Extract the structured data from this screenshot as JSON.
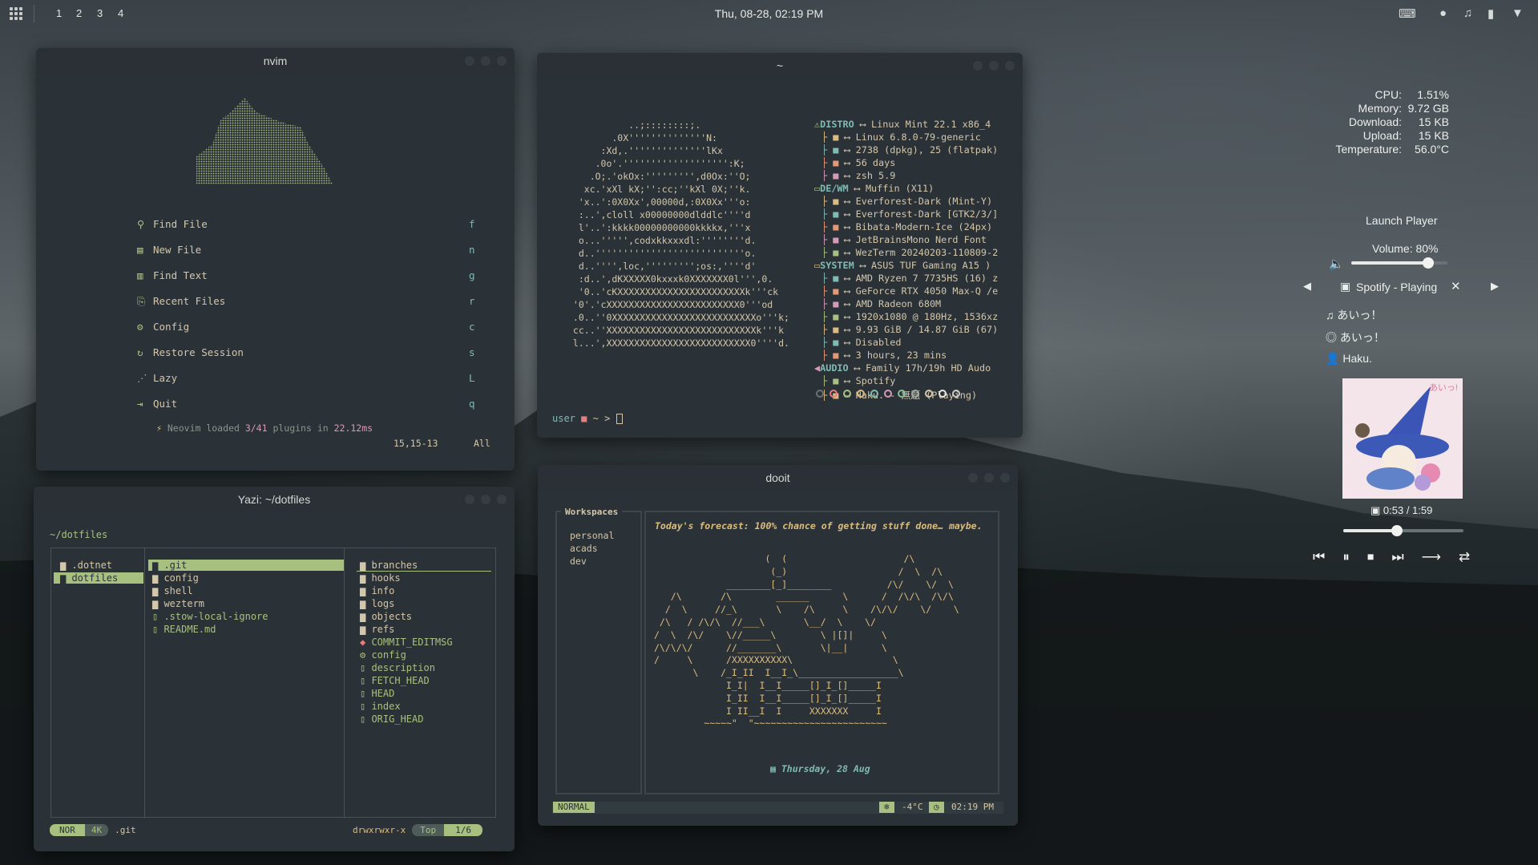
{
  "topbar": {
    "workspaces": [
      "1",
      "2",
      "3",
      "4"
    ],
    "clock": "Thu, 08-28, 02:19 PM"
  },
  "nvim": {
    "title": "nvim",
    "menu": [
      {
        "icon": "search-icon",
        "label": "Find File",
        "key": "f"
      },
      {
        "icon": "file-icon",
        "label": "New File",
        "key": "n"
      },
      {
        "icon": "text-icon",
        "label": "Find Text",
        "key": "g"
      },
      {
        "icon": "history-icon",
        "label": "Recent Files",
        "key": "r"
      },
      {
        "icon": "gear-icon",
        "label": "Config",
        "key": "c"
      },
      {
        "icon": "restore-icon",
        "label": "Restore Session",
        "key": "s"
      },
      {
        "icon": "lazy-icon",
        "label": "Lazy",
        "key": "L"
      },
      {
        "icon": "quit-icon",
        "label": "Quit",
        "key": "q"
      }
    ],
    "footer_prefix": "Neovim loaded ",
    "footer_plugins": "3/41",
    "footer_mid": " plugins in ",
    "footer_time": "22.12ms",
    "cursor_pos": "15,15-13",
    "scroll": "All"
  },
  "terminal": {
    "title": "~",
    "ascii": [
      "           ..;::::::::;.",
      "        .0X''''''''''''''N:",
      "      :Xd,.''''''''''''''lKx",
      "     .0o'.''''''''''''''''''':K;",
      "    .O;.'okOx:''''''''',d0Ox:''O;",
      "   xc.'xXl kX;'':cc;''kXl 0X;''k.",
      "  'x..':0X0Xx',00000d,:0X0Xx'''o:",
      "  :..',cloll x00000000dlddlc''''d",
      "  l'..':kkkk00000000000kkkkx,'''x",
      "  o...''''',codxkkxxxdl:''''''''d.",
      "  d..'''''''''''''''''''''''''''o.",
      "  d..'''',loc,''''''''';os:,''''d'",
      "  :d..',dKXXXXX0kxxxk0XXXXXXX0l''',0.",
      "  '0..'cKXXXXXXXXXXXXXXXXXXXXXXXk'''ck",
      " '0'.'cXXXXXXXXXXXXXXXXXXXXXXXX0'''od",
      " .0..''0XXXXXXXXXXXXXXXXXXXXXXXXXXo'''k;",
      " cc..''XXXXXXXXXXXXXXXXXXXXXXXXXXXk'''k",
      " l...',XXXXXXXXXXXXXXXXXXXXXXXXXX0''''d."
    ],
    "info": [
      {
        "key": "DISTRO",
        "icon": "warning-icon",
        "val": "Linux Mint 22.1 x86_4",
        "header": true
      },
      {
        "key": "",
        "icon": "gear-icon",
        "val": "Linux 6.8.0-79-generic"
      },
      {
        "key": "",
        "icon": "package-icon",
        "val": "2738 (dpkg), 25 (flatpak)"
      },
      {
        "key": "",
        "icon": "uptime-icon",
        "val": "56 days"
      },
      {
        "key": "",
        "icon": "shell-icon",
        "val": "zsh 5.9"
      },
      {
        "key": "DE/WM",
        "icon": "desktop-icon",
        "val": "Muffin (X11)",
        "header": true
      },
      {
        "key": "",
        "icon": "theme-icon",
        "val": "Everforest-Dark (Mint-Y)"
      },
      {
        "key": "",
        "icon": "theme-icon",
        "val": "Everforest-Dark [GTK2/3/]"
      },
      {
        "key": "",
        "icon": "cursor-icon",
        "val": "Bibata-Modern-Ice (24px)"
      },
      {
        "key": "",
        "icon": "font-icon",
        "val": "JetBrainsMono Nerd Font"
      },
      {
        "key": "",
        "icon": "terminal-icon",
        "val": "WezTerm 20240203-110809-2"
      },
      {
        "key": "SYSTEM",
        "icon": "laptop-icon",
        "val": "ASUS TUF Gaming A15 )",
        "header": true
      },
      {
        "key": "",
        "icon": "cpu-icon",
        "val": "AMD Ryzen 7 7735HS (16) z"
      },
      {
        "key": "",
        "icon": "gpu-icon",
        "val": "GeForce RTX 4050 Max-Q /e"
      },
      {
        "key": "",
        "icon": "gpu-icon",
        "val": "AMD Radeon 680M"
      },
      {
        "key": "",
        "icon": "display-icon",
        "val": "1920x1080 @ 180Hz, 1536xz"
      },
      {
        "key": "",
        "icon": "memory-icon",
        "val": "9.93 GiB / 14.87 GiB (67)"
      },
      {
        "key": "",
        "icon": "swap-icon",
        "val": "Disabled"
      },
      {
        "key": "",
        "icon": "clock-icon",
        "val": "3 hours, 23 mins"
      },
      {
        "key": "AUDIO",
        "icon": "speaker-icon",
        "val": "Family 17h/19h HD Audo",
        "header": true
      },
      {
        "key": "",
        "icon": "player-icon",
        "val": "Spotify"
      },
      {
        "key": "",
        "icon": "music-icon",
        "val": "Haku. - 無题 (Playing)"
      }
    ],
    "prompt_user": "user",
    "prompt_path": "~",
    "prompt_arrow": ">"
  },
  "yazi": {
    "title": "Yazi: ~/dotfiles",
    "path": "~/dotfiles",
    "col1": [
      ".dotnet",
      "dotfiles"
    ],
    "col2": [
      ".git",
      "config",
      "shell",
      "wezterm",
      ".stow-local-ignore",
      "README.md"
    ],
    "col3": [
      "branches",
      "hooks",
      "info",
      "logs",
      "objects",
      "refs",
      "COMMIT_EDITMSG",
      "config",
      "description",
      "FETCH_HEAD",
      "HEAD",
      "index",
      "ORIG_HEAD"
    ],
    "mode": "NOR",
    "size": "4K",
    "current": ".git",
    "perms": "drwxrwxr-x",
    "position": "Top",
    "count": "1/6"
  },
  "dooit": {
    "title": "dooit",
    "workspaces_label": "Workspaces",
    "workspaces": [
      "personal",
      "acads",
      "dev"
    ],
    "forecast": "Today's forecast: 100% chance of getting stuff done… maybe.",
    "ascii": [
      "                    (  (                     /\\",
      "                     (_)                    /  \\  /\\",
      "             ________[_]________          /\\/    \\/  \\",
      "   /\\       /\\        ______      \\      /  /\\/\\  /\\/\\",
      "  /  \\     //_\\       \\    /\\     \\    /\\/\\/    \\/    \\",
      " /\\   / /\\/\\  //___\\       \\__/  \\    \\/",
      "/  \\  /\\/    \\//_____\\        \\ |[]|     \\",
      "/\\/\\/\\/      //_______\\       \\|__|      \\",
      "/     \\      /XXXXXXXXXX\\                  \\",
      "       \\    /_I_II  I__I_\\__________________\\",
      "             I_I|  I__I_____[]_I_[]_____I",
      "             I_II  I__I_____[]_I_[]_____I",
      "             I II__I  I     XXXXXXX     I",
      "         ~~~~~\"  \"~~~~~~~~~~~~~~~~~~~~~~~~"
    ],
    "date": "Thursday, 28 Aug",
    "mode": "NORMAL",
    "temp": "-4°C",
    "time": "02:19 PM"
  },
  "stats": {
    "labels": [
      "CPU:",
      "Memory:",
      "Download:",
      "Upload:",
      "Temperature:"
    ],
    "values": [
      "1.51%",
      "9.72 GB",
      "15 KB",
      "15 KB",
      "56.0°C"
    ]
  },
  "player": {
    "launch": "Launch Player",
    "volume_label": "Volume: 80%",
    "volume": 0.8,
    "source": "Spotify - Playing",
    "track": "あいっ！",
    "album": "あいっ！",
    "artist": "Haku.",
    "art_text": "あいっ!",
    "time": "0:53 / 1:59",
    "progress": 0.445
  },
  "colors": {
    "accent_green": "#a7c080",
    "accent_yellow": "#dbbc7f",
    "accent_blue": "#7fbbb3",
    "accent_red": "#e67e80",
    "accent_purple": "#d699b6",
    "bg_window": "#2b3237"
  }
}
